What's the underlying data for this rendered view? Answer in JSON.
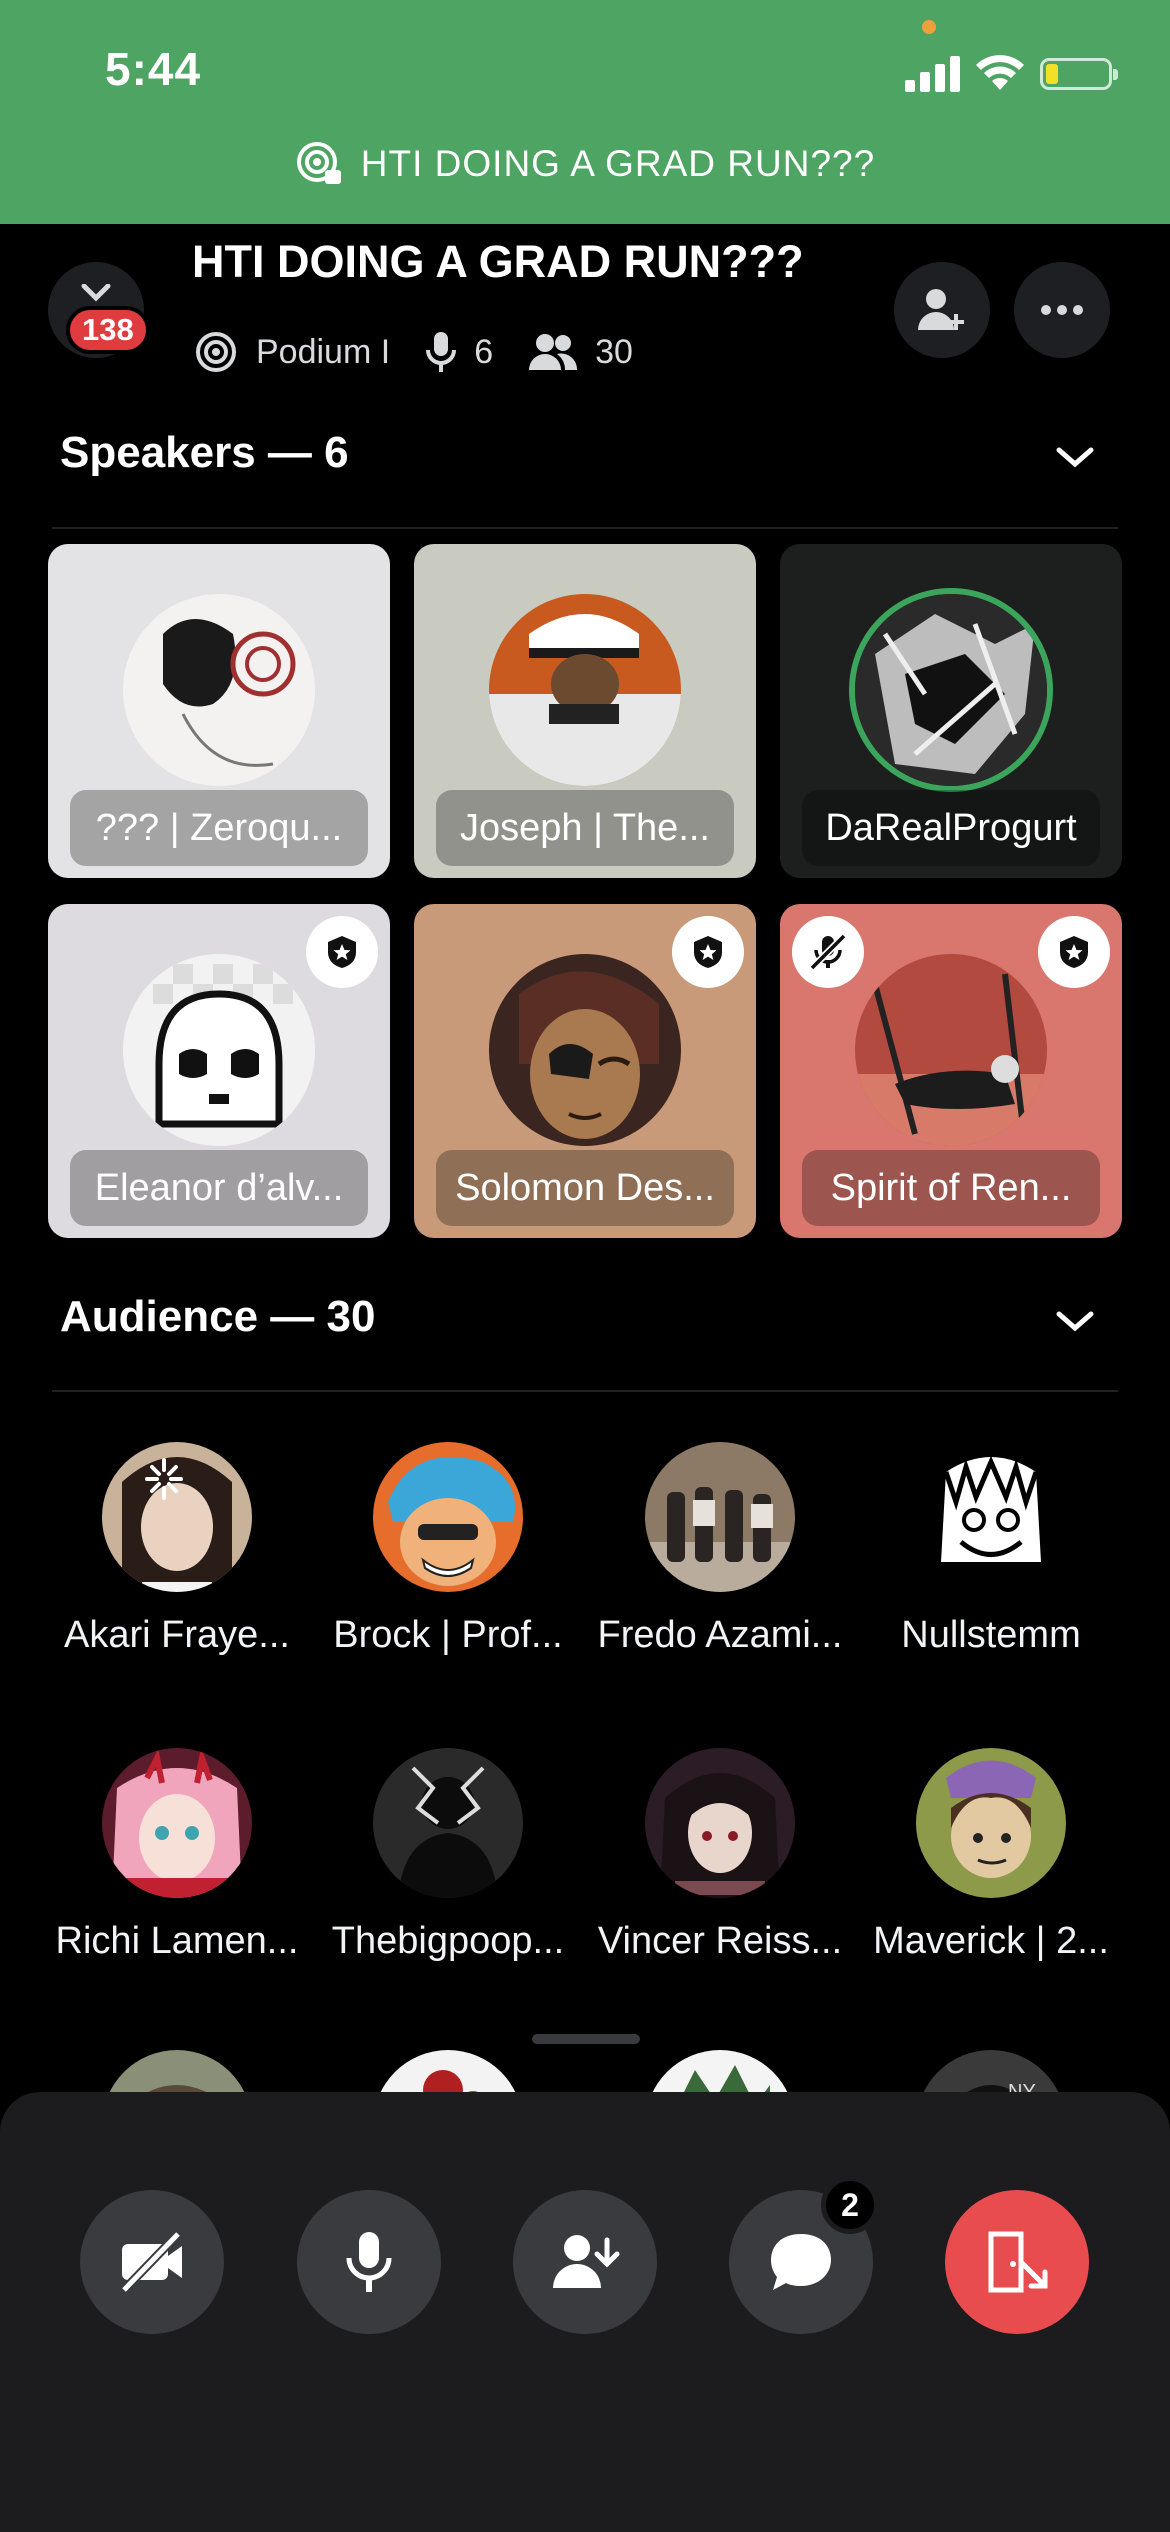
{
  "status_bar": {
    "time": "5:44"
  },
  "banner": {
    "title": "HTI DOING A GRAD RUN???"
  },
  "header": {
    "unread_badge": "138",
    "title": "HTI DOING A GRAD RUN???",
    "stage_label": "Podium I",
    "speaker_count": "6",
    "listener_count": "30"
  },
  "speakers": {
    "title": "Speakers — 6",
    "tiles": [
      {
        "label": "??? | Zeroqu...",
        "bg": "#e3e3e5",
        "moderator": false,
        "muted": false,
        "speaking": false
      },
      {
        "label": "Joseph | The...",
        "bg": "#c9cbc1",
        "moderator": false,
        "muted": false,
        "speaking": false
      },
      {
        "label": "DaRealProgurt",
        "bg": "#1d1f1e",
        "moderator": false,
        "muted": false,
        "speaking": true
      },
      {
        "label": "Eleanor d’alv...",
        "bg": "#dedbe0",
        "moderator": true,
        "muted": false,
        "speaking": false
      },
      {
        "label": "Solomon Des...",
        "bg": "#c89a79",
        "moderator": true,
        "muted": false,
        "speaking": false
      },
      {
        "label": "Spirit of Ren...",
        "bg": "#d9776e",
        "moderator": true,
        "muted": true,
        "speaking": false
      }
    ]
  },
  "audience": {
    "title": "Audience — 30",
    "members": [
      {
        "name": "Akari Fraye..."
      },
      {
        "name": "Brock | Prof..."
      },
      {
        "name": "Fredo Azami..."
      },
      {
        "name": "Nullstemm"
      },
      {
        "name": "Richi Lamen..."
      },
      {
        "name": "Thebigpoop..."
      },
      {
        "name": "Vincer Reiss..."
      },
      {
        "name": "Maverick | 2..."
      }
    ]
  },
  "controls": {
    "unread_messages": "2",
    "items": [
      {
        "icon": "camera-off-icon"
      },
      {
        "icon": "microphone-icon"
      },
      {
        "icon": "invite-to-speak-icon"
      },
      {
        "icon": "chat-bubble-icon"
      },
      {
        "icon": "leave-stage-icon"
      }
    ]
  },
  "colors": {
    "banner": "#4ea462",
    "speaking_ring": "#3ba55c",
    "leave": "#e84c4f",
    "badge": "#e03c3f"
  }
}
